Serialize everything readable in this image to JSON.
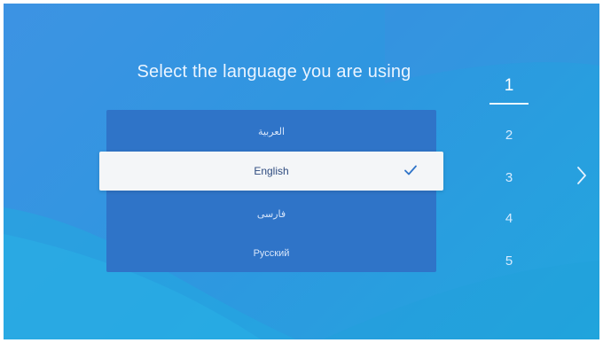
{
  "colors": {
    "background": "#2f96e0",
    "list_bg": "#2f74c8",
    "selected_bg": "#f4f6f8",
    "selected_text": "#2f4c80",
    "check": "#2f74c8"
  },
  "title": "Select the language you are using",
  "languages": [
    {
      "label": "العربية",
      "selected": false
    },
    {
      "label": "English",
      "selected": true
    },
    {
      "label": "فارسی",
      "selected": false
    },
    {
      "label": "Русский",
      "selected": false
    }
  ],
  "steps": [
    "1",
    "2",
    "3",
    "4",
    "5"
  ],
  "current_step": "1",
  "icons": {
    "check": "checkmark-icon",
    "next": "chevron-right-icon"
  }
}
